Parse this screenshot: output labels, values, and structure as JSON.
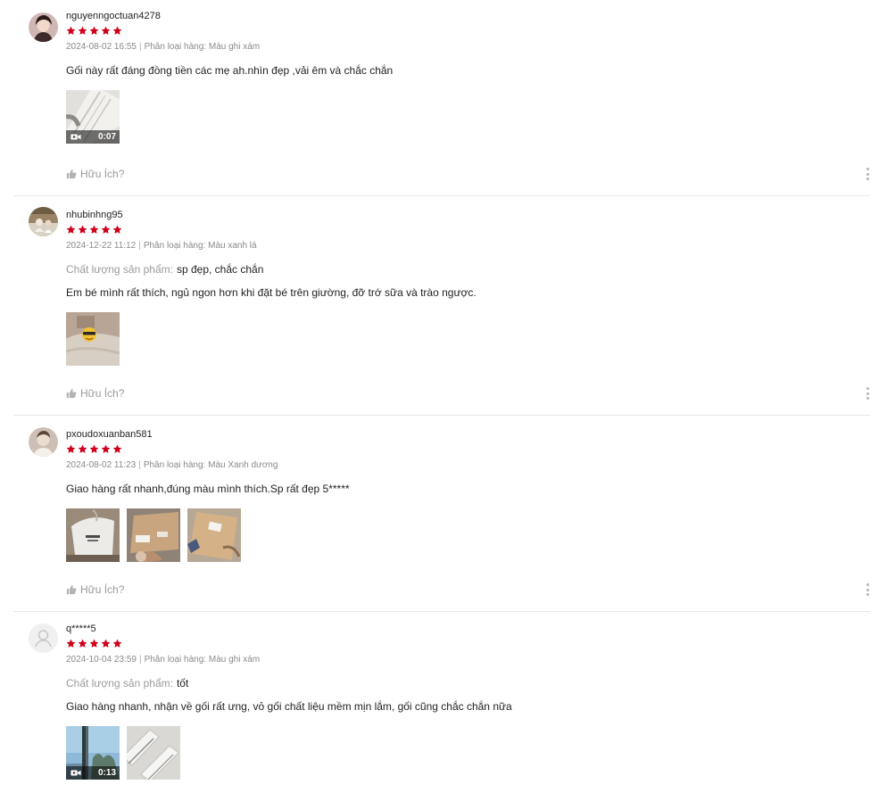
{
  "colors": {
    "star": "#d0011b",
    "meta_text": "#8a8a8a",
    "label_gray": "#9a9a9a",
    "divider": "#e8e8e8"
  },
  "icons": {
    "star": "star-icon",
    "helpful": "thumbs-up-icon",
    "more": "more-vertical-icon",
    "video": "video-camera-icon",
    "default_avatar": "user-icon"
  },
  "helpful_label": "Hữu Ích?",
  "reviews": [
    {
      "username": "nguyenngoctuan4278",
      "rating": 5,
      "date": "2024-08-02 16:55",
      "separator": "|",
      "variation": "Phân loại hàng: Màu ghi xám",
      "quality_label": "",
      "quality_value": "",
      "text": "Gối này rất đáng đồng tiền các mẹ ah.nhìn đẹp ,vải êm và chắc chắn",
      "media": [
        {
          "kind": "video",
          "duration": "0:07"
        }
      ]
    },
    {
      "username": "nhubinhng95",
      "rating": 5,
      "date": "2024-12-22 11:12",
      "separator": "|",
      "variation": "Phân loại hàng: Màu xanh lá",
      "quality_label": "Chất lượng sản phẩm:",
      "quality_value": "sp đẹp, chắc chắn",
      "text": "Em bé mình rất thích, ngủ ngon hơn khi đặt bé trên giường, đỡ trớ sữa và trào ngược.",
      "media": [
        {
          "kind": "image"
        }
      ]
    },
    {
      "username": "pxoudoxuanban581",
      "rating": 5,
      "date": "2024-08-02 11:23",
      "separator": "|",
      "variation": "Phân loại hàng: Màu Xanh dương",
      "quality_label": "",
      "quality_value": "",
      "text": "Giao hàng rất nhanh,đúng màu mình thích.Sp rất đẹp 5*****",
      "media": [
        {
          "kind": "image"
        },
        {
          "kind": "image"
        },
        {
          "kind": "image"
        }
      ]
    },
    {
      "username": "q*****5",
      "rating": 5,
      "date": "2024-10-04 23:59",
      "separator": "|",
      "variation": "Phân loại hàng: Màu ghi xám",
      "quality_label": "Chất lượng sản phẩm:",
      "quality_value": "tốt",
      "text": "Giao hàng nhanh, nhận về gối rất ưng, vỏ gối chất liệu mềm mịn lắm, gối cũng chắc chắn nữa",
      "media": [
        {
          "kind": "video",
          "duration": "0:13"
        },
        {
          "kind": "image"
        }
      ]
    }
  ]
}
